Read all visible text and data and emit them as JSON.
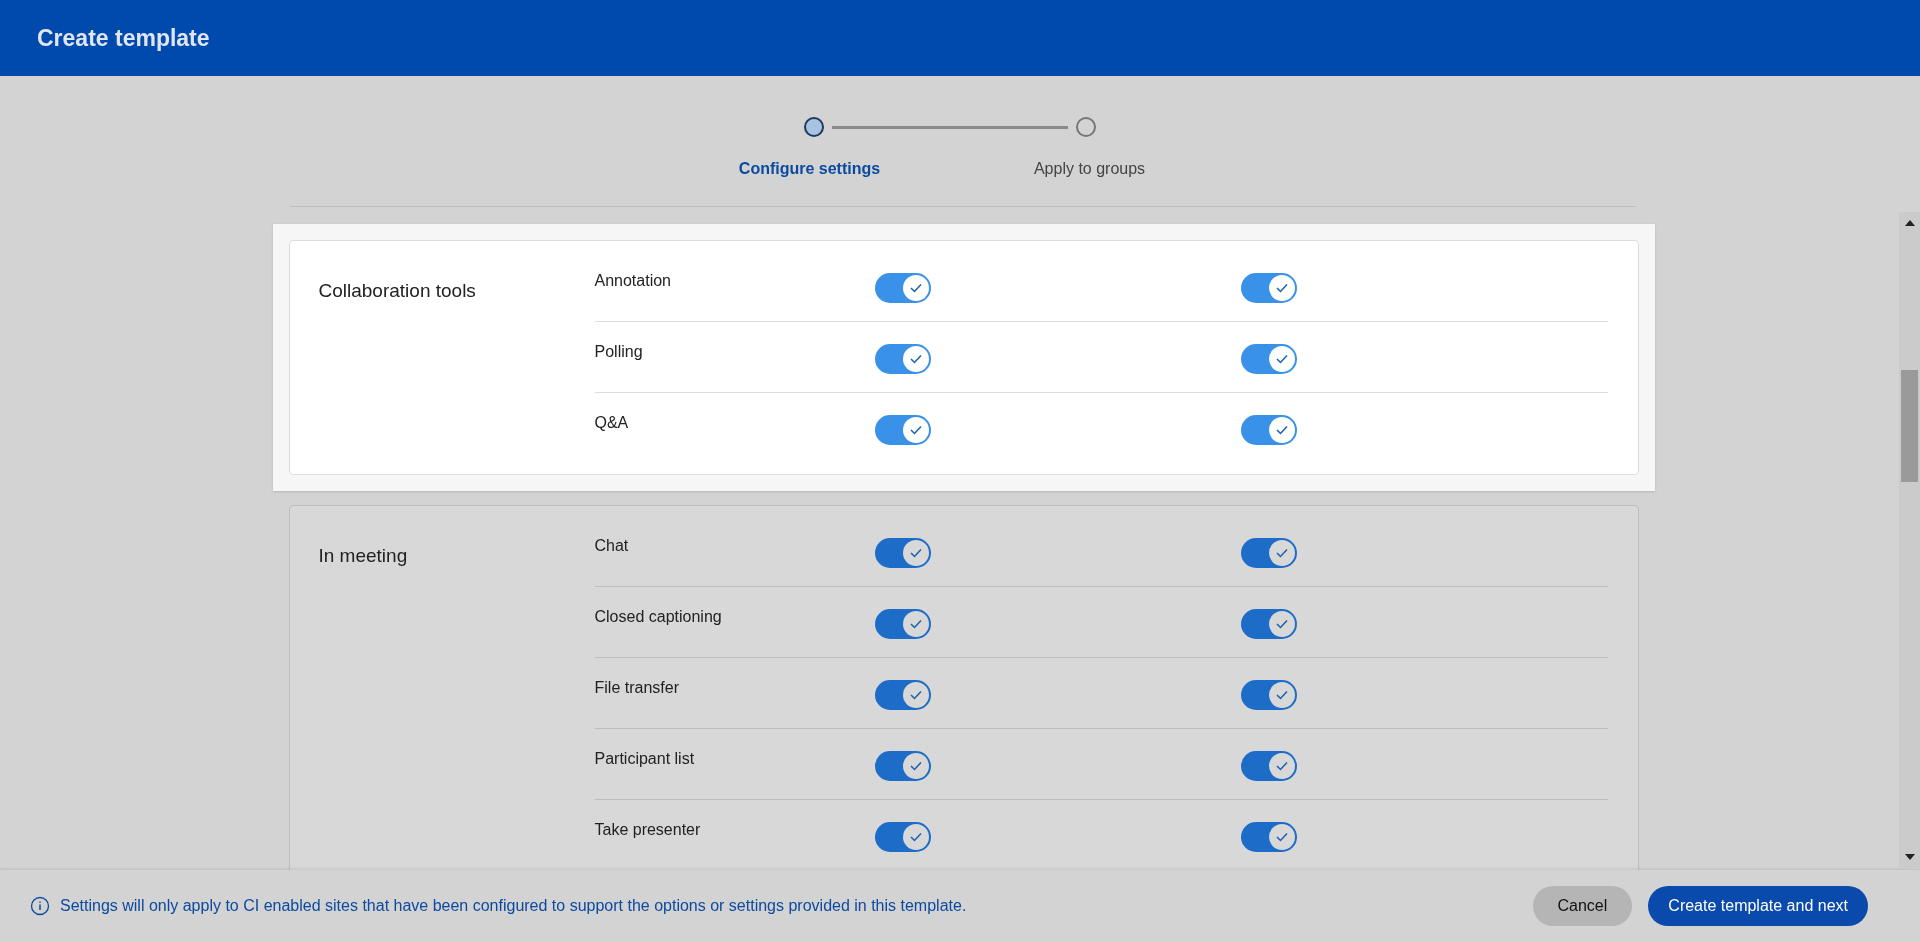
{
  "header": {
    "title": "Create template"
  },
  "steps": [
    {
      "label": "Configure settings",
      "selected": true
    },
    {
      "label": "Apply to groups",
      "selected": false
    }
  ],
  "sections": [
    {
      "title": "Collaboration tools",
      "highlighted": true,
      "rows": [
        {
          "label": "Annotation",
          "toggles": [
            {
              "on": true
            },
            {
              "on": true
            }
          ]
        },
        {
          "label": "Polling",
          "toggles": [
            {
              "on": true
            },
            {
              "on": true
            }
          ]
        },
        {
          "label": "Q&A",
          "toggles": [
            {
              "on": true
            },
            {
              "on": true
            }
          ]
        }
      ]
    },
    {
      "title": "In meeting",
      "highlighted": false,
      "rows": [
        {
          "label": "Chat",
          "toggles": [
            {
              "on": true
            },
            {
              "on": true
            }
          ]
        },
        {
          "label": "Closed captioning",
          "toggles": [
            {
              "on": true
            },
            {
              "on": true
            }
          ]
        },
        {
          "label": "File transfer",
          "toggles": [
            {
              "on": true
            },
            {
              "on": true
            }
          ]
        },
        {
          "label": "Participant list",
          "toggles": [
            {
              "on": true
            },
            {
              "on": true
            }
          ]
        },
        {
          "label": "Take presenter",
          "toggles": [
            {
              "on": true
            },
            {
              "on": true
            }
          ]
        }
      ]
    }
  ],
  "footer": {
    "note": "Settings will only apply to CI enabled sites that have been configured to support the options or settings provided in this template.",
    "buttons": [
      {
        "label": "Cancel",
        "kind": "secondary"
      },
      {
        "label": "Create template and next",
        "kind": "primary"
      }
    ]
  }
}
